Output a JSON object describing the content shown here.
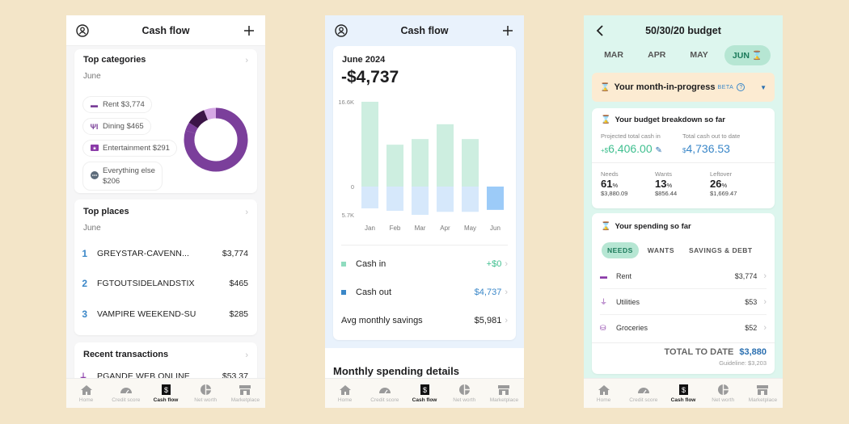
{
  "phone1": {
    "header": {
      "title": "Cash flow"
    },
    "top_categories": {
      "title": "Top categories",
      "period": "June",
      "items": [
        {
          "icon": "bed-icon",
          "label": "Rent $3,774"
        },
        {
          "icon": "fork-knife-icon",
          "label": "Dining $465"
        },
        {
          "icon": "ticket-icon",
          "label": "Entertainment $291"
        },
        {
          "icon": "ellipsis-icon",
          "label": "Everything else",
          "label2": "$206"
        }
      ],
      "donut": [
        {
          "name": "Rent",
          "value": 3774,
          "color": "#7b3f9b"
        },
        {
          "name": "Dining",
          "value": 465,
          "color": "#3b1447"
        },
        {
          "name": "Entertainment",
          "value": 291,
          "color": "#d5a8e4"
        },
        {
          "name": "Everything else",
          "value": 206,
          "color": "#7b3f9b"
        }
      ]
    },
    "top_places": {
      "title": "Top places",
      "period": "June",
      "items": [
        {
          "rank": "1",
          "name": "GREYSTAR-CAVENN...",
          "amount": "$3,774"
        },
        {
          "rank": "2",
          "name": "FGTOUTSIDELANDSTIX",
          "amount": "$465"
        },
        {
          "rank": "3",
          "name": "VAMPIRE WEEKEND-SU",
          "amount": "$285"
        }
      ]
    },
    "recent": {
      "title": "Recent transactions",
      "items": [
        {
          "name": "PGANDE WEB ONLINE",
          "amount": "$53.37"
        }
      ]
    }
  },
  "phone2": {
    "header": {
      "title": "Cash flow"
    },
    "period": "June 2024",
    "net": "-$4,737",
    "cash_in": {
      "label": "Cash in",
      "value": "+$0",
      "color": "#3fbf8f"
    },
    "cash_out": {
      "label": "Cash out",
      "value": "$4,737",
      "color": "#3a87c8"
    },
    "avg": {
      "label": "Avg monthly savings",
      "value": "$5,981"
    },
    "section_title": "Monthly spending details"
  },
  "chart_data": {
    "type": "bar",
    "title": "June 2024",
    "categories": [
      "Jan",
      "Feb",
      "Mar",
      "Apr",
      "May",
      "Jun"
    ],
    "series": [
      {
        "name": "Cash in",
        "values": [
          16.6,
          8.2,
          9.3,
          12.2,
          9.3,
          0
        ],
        "color": "#cdeee0"
      },
      {
        "name": "Cash out",
        "values": [
          -4.4,
          -4.9,
          -5.7,
          -5.1,
          -5.1,
          -4.7
        ],
        "color": "#d6e8fb",
        "highlight_color": "#9ccbf8"
      }
    ],
    "ytick_labels": [
      "16.6K",
      "0",
      "5.7K"
    ],
    "ylim": [
      -5.7,
      16.6
    ],
    "yunit": "thousand USD",
    "highlighted": "Jun"
  },
  "phone3": {
    "header": {
      "title": "50/30/20 budget"
    },
    "months": [
      "MAR",
      "APR",
      "MAY",
      "JUN"
    ],
    "active_month": "JUN",
    "month_in_progress": {
      "label": "Your month-in-progress",
      "badge": "BETA",
      "help": "?"
    },
    "breakdown": {
      "title": "Your budget breakdown so far",
      "projected_label": "Projected total cash in",
      "projected_prefix": "+$",
      "projected_value": "6,406.00",
      "cashout_label": "Total cash out to date",
      "cashout_prefix": "$",
      "cashout_value": "4,736.53",
      "stats": [
        {
          "label": "Needs",
          "pct": "61",
          "amount": "$3,880.09"
        },
        {
          "label": "Wants",
          "pct": "13",
          "amount": "$856.44"
        },
        {
          "label": "Leftover",
          "pct": "26",
          "amount": "$1,669.47"
        }
      ]
    },
    "spending": {
      "title": "Your spending so far",
      "tabs": [
        "NEEDS",
        "WANTS",
        "SAVINGS & DEBT"
      ],
      "active_tab": "NEEDS",
      "rows": [
        {
          "icon": "bed-icon",
          "label": "Rent",
          "amount": "$3,774"
        },
        {
          "icon": "plug-icon",
          "label": "Utilities",
          "amount": "$53"
        },
        {
          "icon": "basket-icon",
          "label": "Groceries",
          "amount": "$52"
        }
      ],
      "total_label": "TOTAL TO DATE",
      "total_value": "$3,880",
      "guideline": "Guideline: $3,203"
    }
  },
  "tabbar": {
    "items": [
      {
        "label": "Home",
        "icon": "home-icon"
      },
      {
        "label": "Credit score",
        "icon": "gauge-icon"
      },
      {
        "label": "Cash flow",
        "icon": "dollar-receipt-icon"
      },
      {
        "label": "Net worth",
        "icon": "pie-icon"
      },
      {
        "label": "Marketplace",
        "icon": "store-icon"
      }
    ],
    "active": "Cash flow"
  }
}
